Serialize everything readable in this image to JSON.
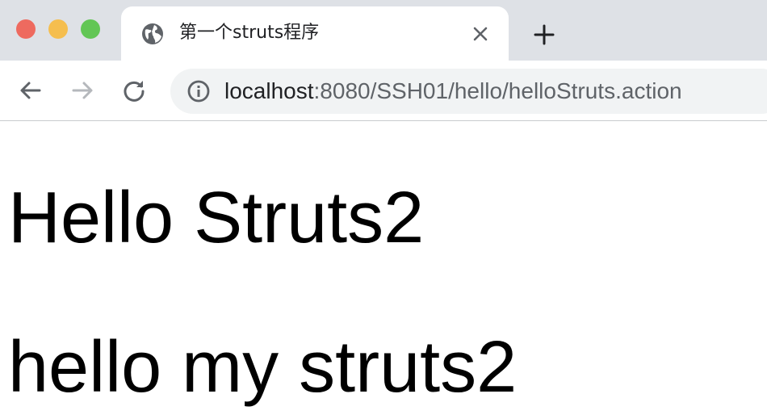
{
  "window": {
    "controls": [
      "close",
      "minimize",
      "maximize"
    ],
    "colors": {
      "close": "#ee6a5f",
      "minimize": "#f5be4f",
      "maximize": "#62c655"
    }
  },
  "tab": {
    "title": "第一个struts程序",
    "favicon": "globe-icon"
  },
  "toolbar": {
    "back_icon": "back-arrow-icon",
    "forward_icon": "forward-arrow-icon",
    "reload_icon": "reload-icon",
    "info_icon": "info-icon",
    "url_host": "localhost",
    "url_rest": ":8080/SSH01/hello/helloStruts.action"
  },
  "page": {
    "heading1": "Hello Struts2",
    "heading2": "hello my struts2"
  }
}
